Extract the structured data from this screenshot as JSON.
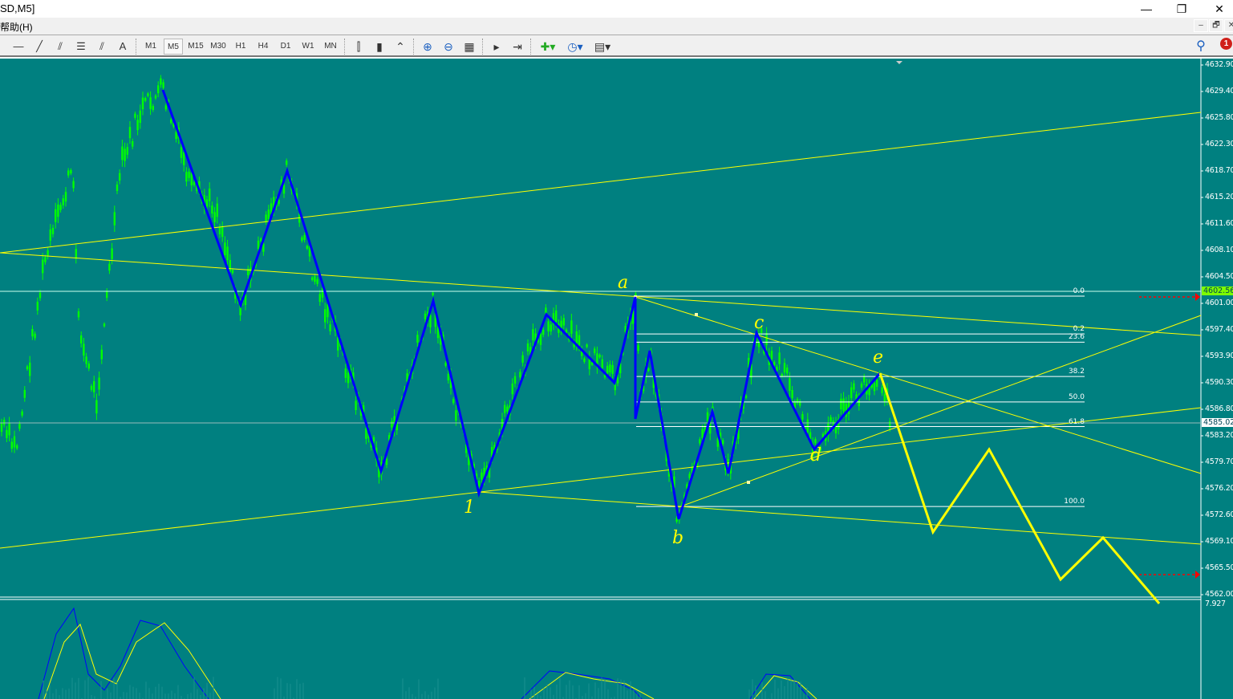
{
  "window": {
    "title": "SD,M5]",
    "minimize": "—",
    "restore": "❐",
    "close": "✕"
  },
  "menu": {
    "help": "帮助(H)",
    "mdi": [
      "–",
      "🗗",
      "✕"
    ]
  },
  "toolbar": {
    "tools": [
      {
        "icon": "horizontal-line-icon",
        "glyph": "—"
      },
      {
        "icon": "trendline-icon",
        "glyph": "╱"
      },
      {
        "icon": "equidistant-channel-icon",
        "glyph": "⫽"
      },
      {
        "icon": "fibonacci-retracement-icon",
        "glyph": "☰"
      },
      {
        "icon": "fibonacci-fan-icon",
        "glyph": "⫽"
      },
      {
        "icon": "text-icon",
        "glyph": "A"
      }
    ],
    "periods": [
      "M1",
      "M5",
      "M15",
      "M30",
      "H1",
      "H4",
      "D1",
      "W1",
      "MN"
    ],
    "selected_period": "M5",
    "chart_tools": [
      {
        "icon": "bar-chart-icon",
        "glyph": "⫿"
      },
      {
        "icon": "candlestick-icon",
        "glyph": "▮"
      },
      {
        "icon": "line-chart-icon",
        "glyph": "⌃"
      },
      {
        "icon": "zoom-in-icon",
        "glyph": "⊕"
      },
      {
        "icon": "zoom-out-icon",
        "glyph": "⊖"
      },
      {
        "icon": "tile-windows-icon",
        "glyph": "▦"
      },
      {
        "icon": "auto-scroll-icon",
        "glyph": "▸"
      },
      {
        "icon": "chart-shift-icon",
        "glyph": "⇥"
      },
      {
        "icon": "indicators-icon",
        "glyph": "✚▾"
      },
      {
        "icon": "periods-clock-icon",
        "glyph": "◷▾"
      },
      {
        "icon": "templates-icon",
        "glyph": "▤▾"
      }
    ],
    "search_icon": "⚲",
    "notifications_count": "1"
  },
  "chart": {
    "background": "#008080",
    "candle_color": "#00ff00",
    "wave_color": "#0000ff",
    "drawing_color": "#ffff00",
    "price_axis": [
      "4632.90",
      "4629.40",
      "4625.80",
      "4622.30",
      "4618.70",
      "4615.20",
      "4611.60",
      "4608.10",
      "4604.50",
      "4601.00",
      "4597.40",
      "4593.90",
      "4590.30",
      "4586.80",
      "4583.20",
      "4579.70",
      "4576.20",
      "4572.60",
      "4569.10",
      "4565.50",
      "4562.00"
    ],
    "current_price": "4602.56",
    "line_price": "4585.02",
    "fib_levels": [
      {
        "label": "0.0",
        "price": 4602.56
      },
      {
        "label": "0.2",
        "price": 4596.9
      },
      {
        "label": "23.6",
        "price": 4595.8
      },
      {
        "label": "38.2",
        "price": 4591.2
      },
      {
        "label": "50.0",
        "price": 4587.8
      },
      {
        "label": "61.8",
        "price": 4584.5
      },
      {
        "label": "100.0",
        "price": 4573.8
      }
    ],
    "wave_labels": [
      "a",
      "b",
      "c",
      "d",
      "e",
      "1"
    ],
    "indicator_value": "7.927"
  }
}
